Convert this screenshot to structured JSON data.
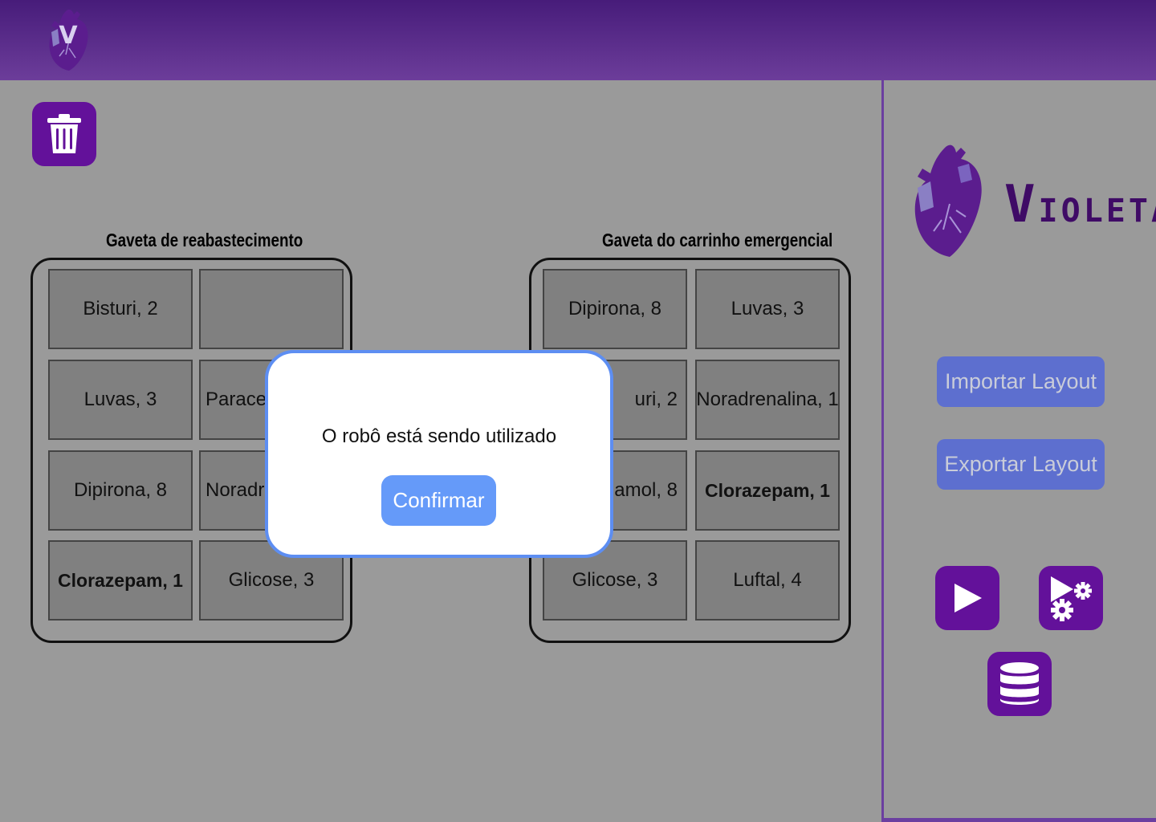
{
  "header": {
    "logo_letter": "V"
  },
  "toolbar": {
    "delete_icon": "trash-icon"
  },
  "drawers": {
    "refill": {
      "title": "Gaveta de reabastecimento",
      "cells": [
        "Bisturi, 2",
        "",
        "Luvas, 3",
        "Paracet",
        "Dipirona, 8",
        "Noradre",
        "Clorazepam, 1",
        "Glicose, 3"
      ]
    },
    "emergency": {
      "title": "Gaveta do carrinho emergencial",
      "cells": [
        "Dipirona, 8",
        "Luvas, 3",
        "uri, 2",
        "Noradrenalina, 1",
        "amol, 8",
        "Clorazepam, 1",
        "Glicose, 3",
        "Luftal, 4"
      ]
    }
  },
  "sidebar": {
    "brand_initial": "V",
    "brand_rest": "IOLETA",
    "import_label": "Importar Layout",
    "export_label": "Exportar Layout",
    "icons": [
      "play-icon",
      "play-settings-icon",
      "database-icon"
    ]
  },
  "modal": {
    "message": "O robô está sendo utilizado",
    "confirm_label": "Confirmar"
  },
  "colors": {
    "header": "#4a1d7c",
    "accent_purple": "#63119a",
    "button_blue": "#5d6fcf",
    "modal_border": "#5d8ef2",
    "confirm_blue": "#659af9"
  }
}
